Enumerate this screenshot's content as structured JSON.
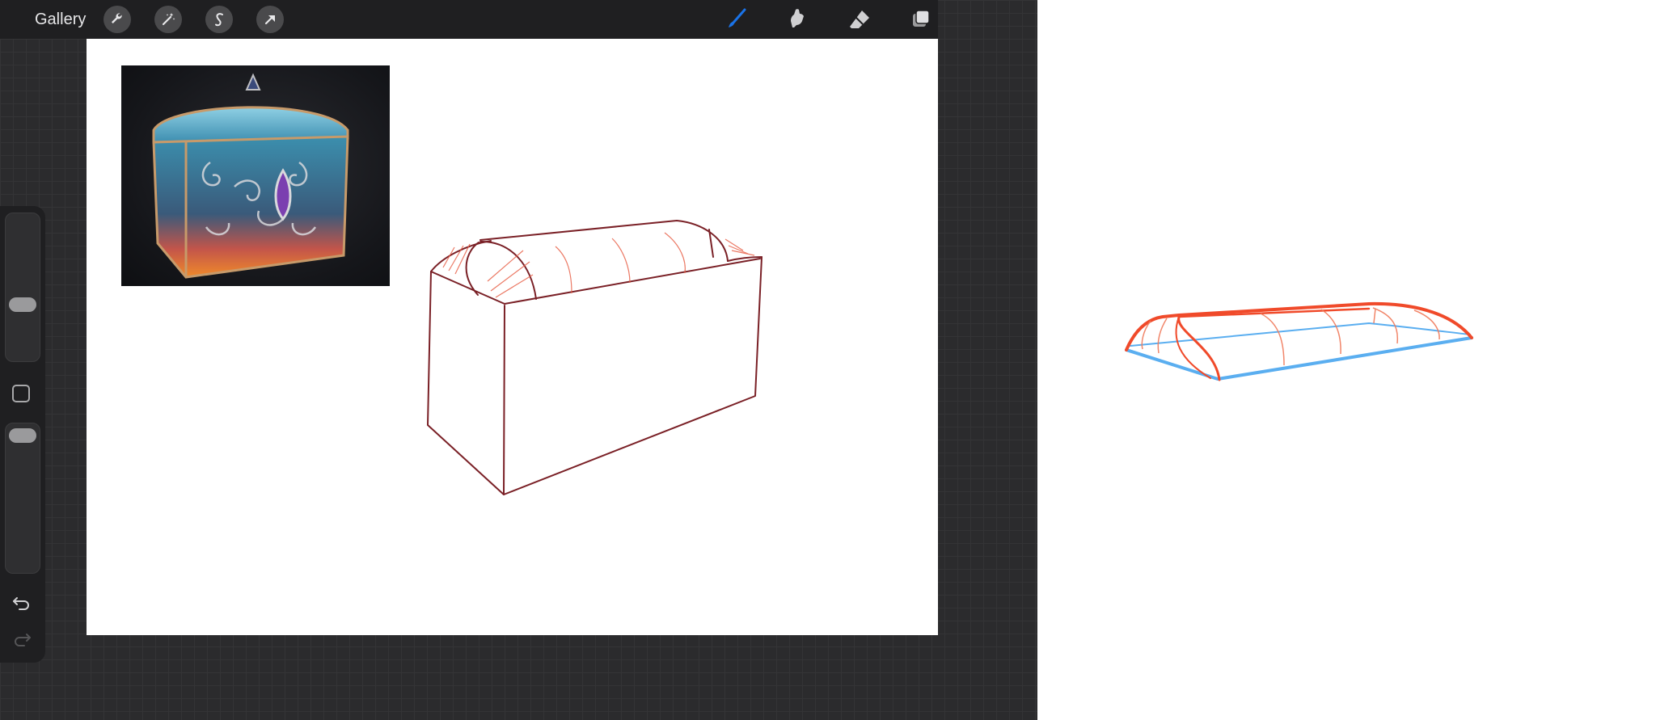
{
  "toolbar": {
    "gallery_label": "Gallery",
    "left_tools": [
      "wrench-icon",
      "magic-wand-icon",
      "selection-s-icon",
      "transform-arrow-icon"
    ],
    "right_tools": [
      "brush-icon",
      "smudge-icon",
      "eraser-icon",
      "layers-icon"
    ],
    "active_tool": "brush-icon",
    "active_color": "#1a73e8"
  },
  "sidebar": {
    "controls": [
      "brush-size-slider",
      "modify-button",
      "opacity-slider",
      "undo-icon",
      "redo-icon"
    ]
  },
  "colors": {
    "sketch_dark_red": "#7a2026",
    "sketch_light_red": "#e8624a",
    "sketch_orange_red": "#f04a2a",
    "sketch_blue": "#5aaef0"
  }
}
